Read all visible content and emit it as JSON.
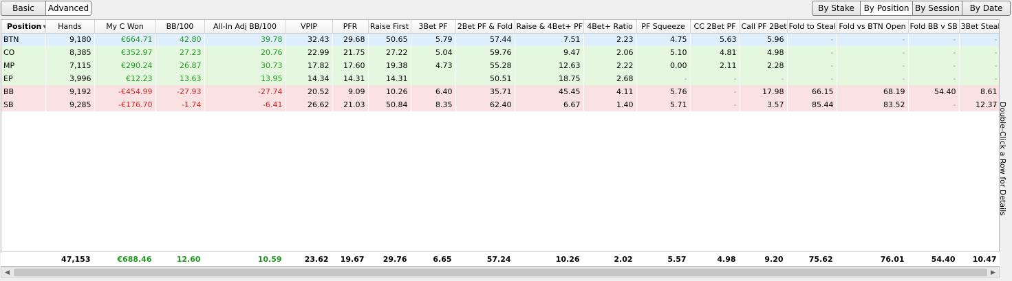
{
  "toolbar": {
    "basic_label": "Basic",
    "advanced_label": "Advanced",
    "by_stake_label": "By Stake",
    "by_position_label": "By Position",
    "by_session_label": "By Session",
    "by_date_label": "By Date"
  },
  "table": {
    "columns": [
      "Position",
      "Hands",
      "My C Won",
      "BB/100",
      "All-In Adj BB/100",
      "VPIP",
      "PFR",
      "Raise First",
      "3Bet PF",
      "2Bet PF & Fold",
      "Raise & 4Bet+ PF",
      "4Bet+ Ratio",
      "PF Squeeze",
      "CC 2Bet PF",
      "Call PF 2Bet",
      "Fold to Steal",
      "Fold vs BTN Open",
      "Fold BB v SB",
      "3Bet Steal"
    ],
    "rows": [
      {
        "cells": [
          "BTN",
          "9,180",
          "€664.71",
          "42.80",
          "39.78",
          "32.43",
          "29.68",
          "50.65",
          "5.79",
          "57.44",
          "7.51",
          "2.23",
          "4.75",
          "5.63",
          "5.96",
          "-",
          "-",
          "-",
          "-"
        ]
      },
      {
        "cells": [
          "CO",
          "8,385",
          "€352.97",
          "27.23",
          "20.76",
          "22.99",
          "21.75",
          "27.22",
          "5.04",
          "59.76",
          "9.47",
          "2.06",
          "5.10",
          "4.81",
          "4.98",
          "-",
          "-",
          "-",
          "-"
        ]
      },
      {
        "cells": [
          "MP",
          "7,115",
          "€290.24",
          "26.87",
          "30.73",
          "17.82",
          "17.60",
          "19.38",
          "4.73",
          "55.28",
          "12.63",
          "2.22",
          "0.00",
          "2.11",
          "2.28",
          "-",
          "-",
          "-",
          "-"
        ]
      },
      {
        "cells": [
          "EP",
          "3,996",
          "€12.23",
          "13.63",
          "13.95",
          "14.34",
          "14.31",
          "14.31",
          "",
          "50.51",
          "18.75",
          "2.68",
          "-",
          "-",
          "-",
          "-",
          "-",
          "-",
          "-"
        ]
      },
      {
        "cells": [
          "BB",
          "9,192",
          "-€454.99",
          "-27.93",
          "-27.74",
          "20.52",
          "9.09",
          "10.26",
          "6.40",
          "35.71",
          "45.45",
          "4.11",
          "5.76",
          "-",
          "17.98",
          "66.15",
          "68.19",
          "54.40",
          "8.61"
        ]
      },
      {
        "cells": [
          "SB",
          "9,285",
          "-€176.70",
          "-1.74",
          "-6.41",
          "26.62",
          "21.03",
          "50.84",
          "8.35",
          "62.40",
          "6.67",
          "1.40",
          "5.71",
          "-",
          "3.57",
          "85.44",
          "83.52",
          "-",
          "12.37"
        ]
      }
    ],
    "totals": [
      "",
      "47,153",
      "€688.46",
      "12.60",
      "10.59",
      "23.62",
      "19.67",
      "29.76",
      "6.65",
      "57.24",
      "10.26",
      "2.02",
      "5.57",
      "4.98",
      "9.20",
      "75.62",
      "76.01",
      "54.40",
      "10.47"
    ]
  },
  "side_hint": "Double-Click a Row for Details",
  "colors": {
    "positive": "#1d9a1d",
    "negative": "#d62626",
    "row_selected": "#dfeefb",
    "row_winning": "#e6f7e0",
    "row_losing": "#fbe2e2"
  }
}
